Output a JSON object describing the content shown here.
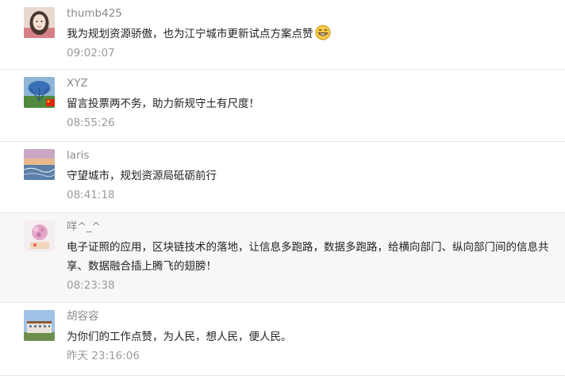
{
  "comments": [
    {
      "name": "thumb425",
      "text": "我为规划资源骄傲，也为江宁城市更新试点方案点赞",
      "time": "09:02:07",
      "emoji": "grinning-face-icon"
    },
    {
      "name": "XYZ",
      "text": "留言投票两不务，助力新规守土有尺度！",
      "time": "08:55:26"
    },
    {
      "name": "laris",
      "text": "守望城市，规划资源局砥砺前行",
      "time": "08:41:18"
    },
    {
      "name": "咩^_^",
      "text": "电子证照的应用，区块链技术的落地，让信息多跑路，数据多跑路，给横向部门、纵向部门间的信息共享、数据融合插上腾飞的翅膀！",
      "time": "08:23:38"
    },
    {
      "name": "胡容容",
      "text": "为你们的工作点赞，为人民，想人民，便人民。",
      "time": "昨天 23:16:06"
    }
  ],
  "colors": {
    "name": "#8a8a8a",
    "text": "#222222",
    "time": "#9a9a9a",
    "divider": "#e6e6e6",
    "highlight_bg": "#f7f7f7"
  }
}
